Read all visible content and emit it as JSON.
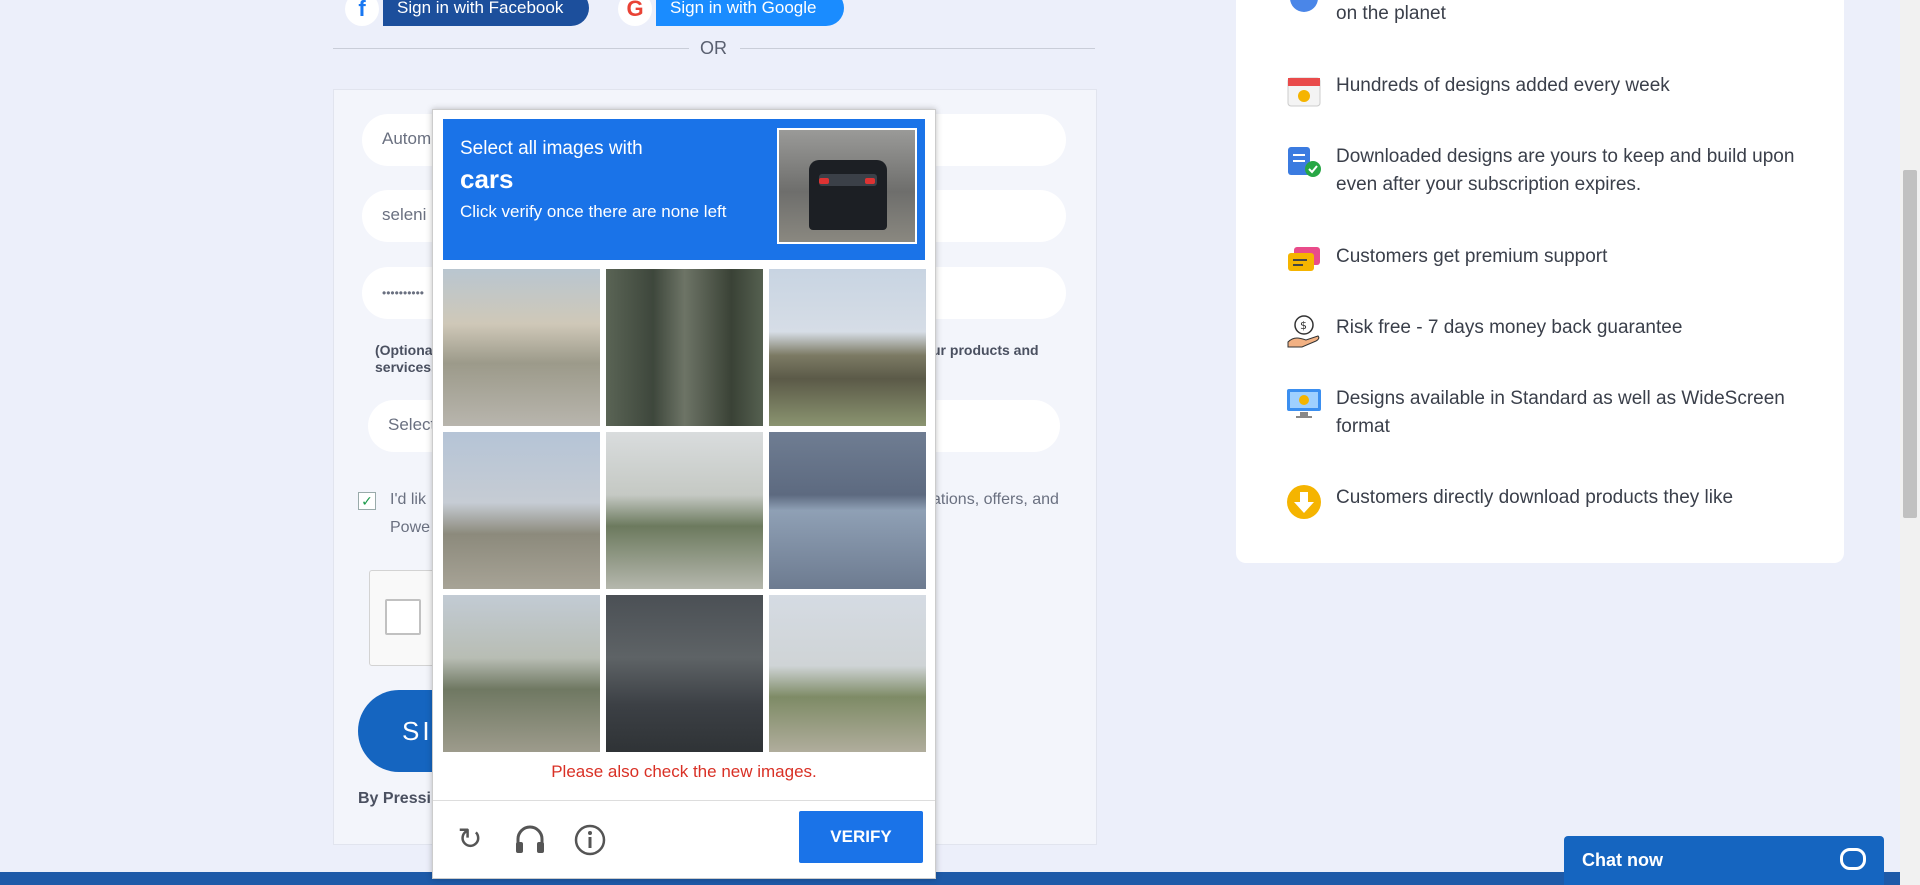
{
  "social": {
    "facebook_label": "Sign in with Facebook",
    "google_label": "Sign in with Google",
    "or_text": "OR"
  },
  "form": {
    "name_value": "Autom",
    "email_value": "seleni",
    "password_value": "••••••••••",
    "optional_text_line1": "(Optiona",
    "optional_text_line1_right": "ur products and",
    "optional_text_line2": "services.",
    "select_value": "Select",
    "consent_line1_left": "I'd lik",
    "consent_line1_right": "ations, offers, and",
    "consent_line2": "Powe",
    "signup_label": "SI",
    "by_text": "By Pressi"
  },
  "features": {
    "items": [
      {
        "icon": "globe-icon",
        "text": "on the planet"
      },
      {
        "icon": "calendar-icon",
        "text": "Hundreds of designs added every week"
      },
      {
        "icon": "clipboard-check-icon",
        "text": "Downloaded designs are yours to keep and build upon even after your subscription expires."
      },
      {
        "icon": "chat-bubbles-icon",
        "text": "Customers get premium support"
      },
      {
        "icon": "money-hand-icon",
        "text": "Risk free - 7 days money back guarantee"
      },
      {
        "icon": "monitor-icon",
        "text": "Designs available in Standard as well as WideScreen format"
      },
      {
        "icon": "download-circle-icon",
        "text": "Customers directly download products they like"
      }
    ]
  },
  "captcha": {
    "instruction": "Select all images with",
    "target": "cars",
    "subinstruction": "Click verify once there are none left",
    "message": "Please also check the new images.",
    "verify_label": "VERIFY",
    "footer_icons": [
      "reload-icon",
      "audio-icon",
      "info-icon"
    ]
  },
  "chat": {
    "label": "Chat now"
  },
  "colors": {
    "captcha_blue": "#1a73e8",
    "error_red": "#d93025",
    "brand_blue": "#1565c0",
    "page_bg": "#eceffa"
  }
}
